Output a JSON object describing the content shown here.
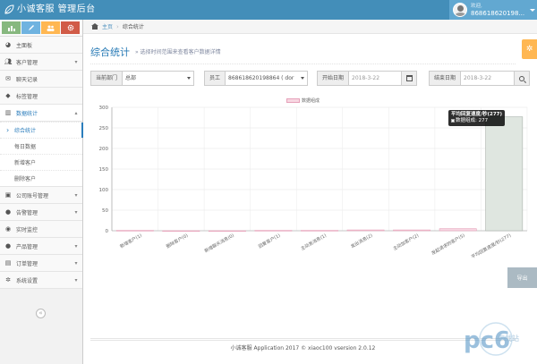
{
  "app": {
    "title": "小诚客服 管理后台",
    "user_greeting": "欢迎,",
    "user_name": "868618620198...",
    "colors": {
      "topbar": "#438eb9",
      "accent": "#2679b5"
    }
  },
  "shortcuts": [
    {
      "icon": "chart-icon",
      "color": "#87b87f"
    },
    {
      "icon": "pencil-icon",
      "color": "#6fb3e0"
    },
    {
      "icon": "group-icon",
      "color": "#ffb752"
    },
    {
      "icon": "cogs-icon",
      "color": "#d15b47"
    }
  ],
  "sidebar": {
    "items": [
      {
        "label": "主面板",
        "icon": "dashboard-icon"
      },
      {
        "label": "客户管理",
        "icon": "users-icon"
      },
      {
        "label": "聊天记录",
        "icon": "comments-icon"
      },
      {
        "label": "标签管理",
        "icon": "tag-icon"
      },
      {
        "label": "数据统计",
        "icon": "bar-chart-icon",
        "open": true,
        "children": [
          {
            "label": "综合统计",
            "active": true
          },
          {
            "label": "每日数据"
          },
          {
            "label": "新增客户"
          },
          {
            "label": "删除客户"
          }
        ]
      },
      {
        "label": "公司账号管理",
        "icon": "briefcase-icon"
      },
      {
        "label": "告警管理",
        "icon": "warning-icon"
      },
      {
        "label": "实时监控",
        "icon": "eye-icon"
      },
      {
        "label": "产品管理",
        "icon": "gift-icon"
      },
      {
        "label": "订单管理",
        "icon": "list-icon"
      },
      {
        "label": "系统设置",
        "icon": "gear-icon"
      }
    ]
  },
  "breadcrumb": {
    "home": "主页",
    "current": "综合统计"
  },
  "page": {
    "title": "综合统计",
    "subtitle": "选择时间范围来查看客户数据详情"
  },
  "filters": {
    "department_label": "当前部门",
    "department_value": "总部",
    "employee_label": "员工",
    "employee_value": "868618620198864 ( dor",
    "start_label": "开始日期",
    "start_value": "2018-3-22",
    "end_label": "结束日期",
    "end_value": "2018-3-22"
  },
  "chart_data": {
    "type": "bar",
    "categories": [
      "新增客户(1)",
      "删除客户(0)",
      "新增聊天消息(0)",
      "回复客户(1)",
      "主动发消息(1)",
      "发出消息(2)",
      "主动加客户(2)",
      "发起请求的客户(5)",
      "平均回复速度/秒(277)"
    ],
    "series": [
      {
        "name": "数据组成",
        "values": [
          1,
          0,
          0,
          1,
          1,
          2,
          2,
          5,
          277
        ]
      }
    ],
    "ylim": [
      0,
      300
    ],
    "yticks": [
      0,
      50,
      100,
      150,
      200,
      250,
      300
    ],
    "grid": true,
    "legend": "top-center",
    "tooltip": {
      "title": "平均回复速度/秒(277)",
      "series": "数据组成",
      "value": 277
    }
  },
  "export_label": "导出",
  "footer": "小诚客服 Application 2017 © xiaoc100 vsersion 2.0.12",
  "watermark": "pc6 下载站"
}
